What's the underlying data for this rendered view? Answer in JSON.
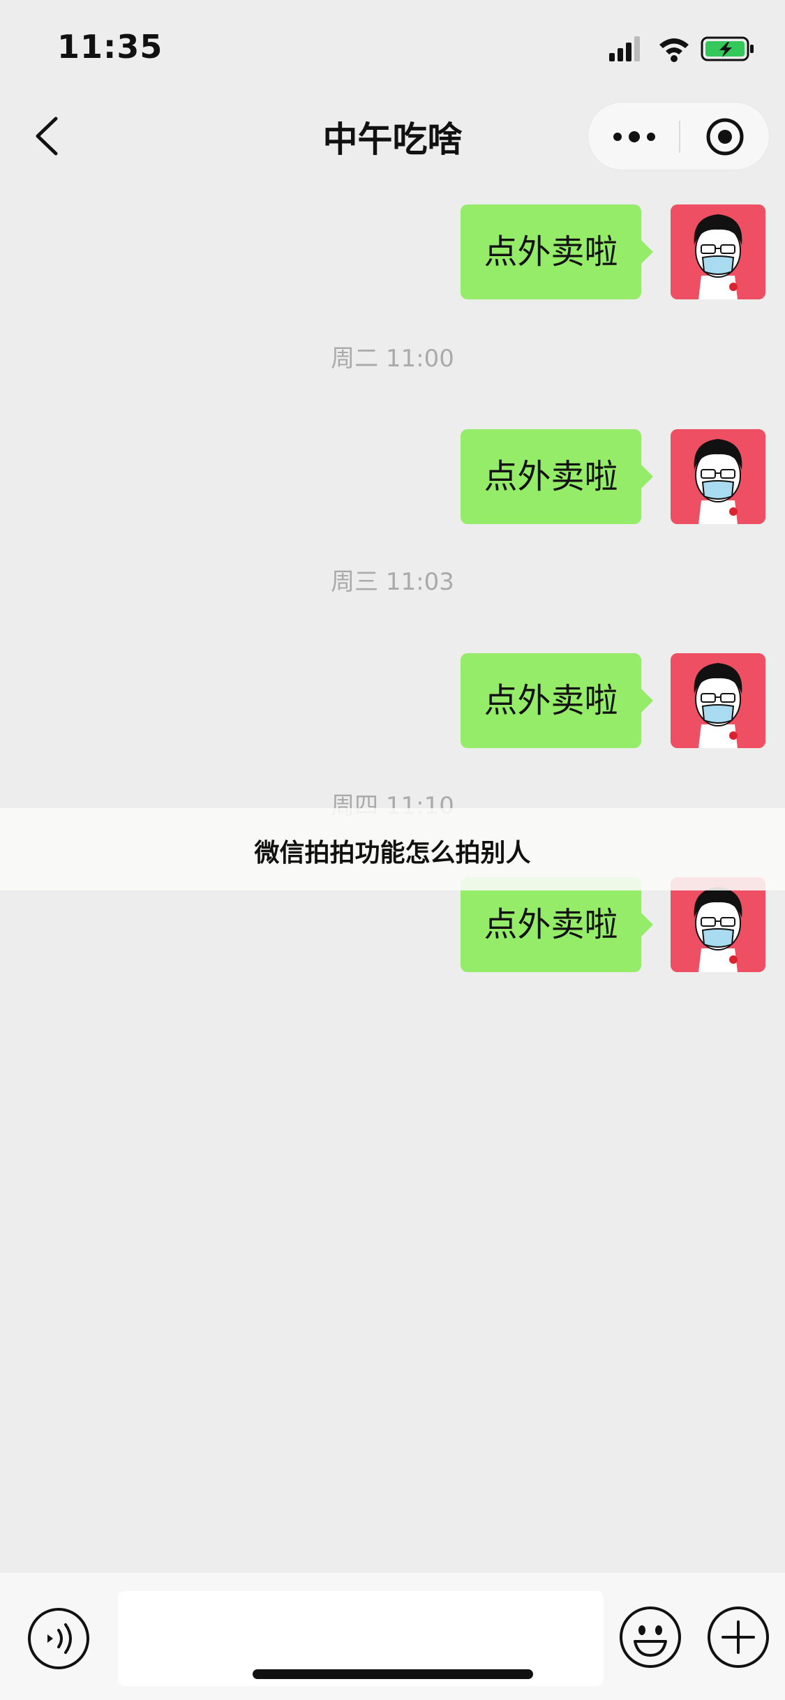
{
  "status_bar": {
    "time": "11:35"
  },
  "nav": {
    "title": "中午吃啥",
    "back_icon": "chevron-left-icon",
    "more_icon": "more-dots-icon",
    "close_icon": "target-circle-icon"
  },
  "messages": [
    {
      "text": "点外卖啦"
    },
    {
      "text": "点外卖啦"
    },
    {
      "text": "点外卖啦"
    },
    {
      "text": "点外卖啦"
    }
  ],
  "timestamps": [
    "周二 11:00",
    "周三 11:03",
    "周四 11:10"
  ],
  "caption": "微信拍拍功能怎么拍别人",
  "input_bar": {
    "voice_icon": "voice-icon",
    "emoji_icon": "emoji-icon",
    "plus_icon": "plus-icon",
    "input_value": ""
  },
  "colors": {
    "background": "#ededed",
    "bubble": "#95ec69",
    "avatar_bg": "#ef4f62",
    "timestamp": "#aaaaaa"
  }
}
